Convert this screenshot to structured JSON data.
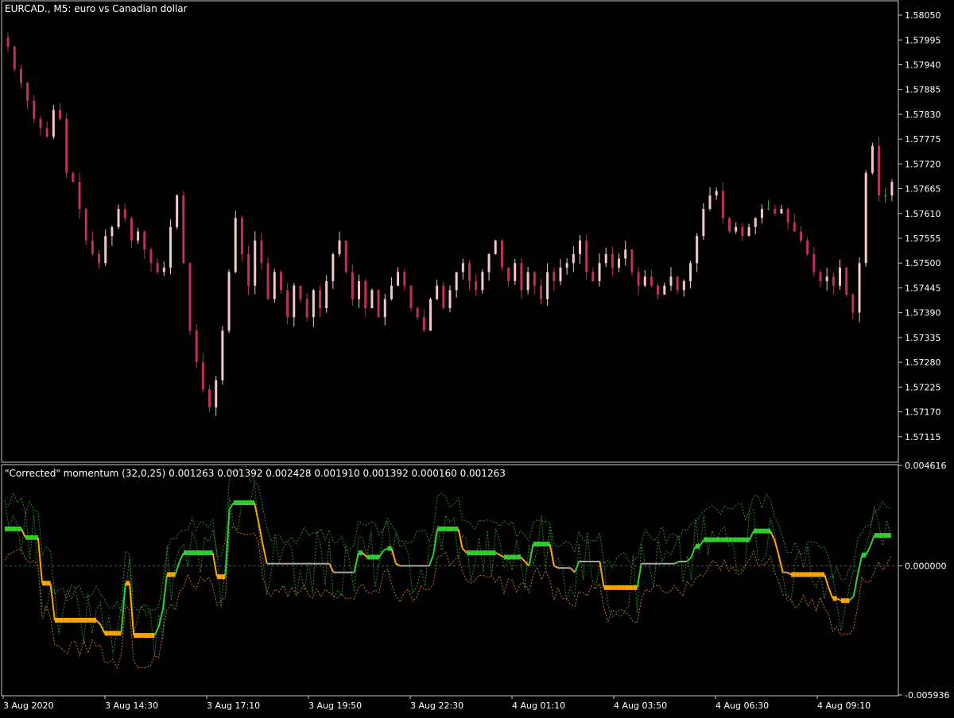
{
  "colors": {
    "background": "#000000",
    "frame": "#C8C8C8",
    "text": "#FFFFFF",
    "bull_candle": "#F4C7C9",
    "bear_candle": "#C0305A",
    "doji_candle": "#3CB43C",
    "momentum_up": "#32CD32",
    "momentum_down": "#FFA500",
    "momentum_neutral": "#A9A9A9",
    "band_green": "#2E8B2E",
    "band_orange": "#C07A20",
    "zero_line": "#555555"
  },
  "main_panel": {
    "title": "EURCAD., M5:  euro vs Canadian dollar",
    "y_ticks": [
      "1.58050",
      "1.57995",
      "1.57940",
      "1.57885",
      "1.57830",
      "1.57775",
      "1.57720",
      "1.57665",
      "1.57610",
      "1.57555",
      "1.57500",
      "1.57445",
      "1.57390",
      "1.57335",
      "1.57280",
      "1.57225",
      "1.57170",
      "1.57115"
    ]
  },
  "indicator_panel": {
    "title": "\"Corrected\" momentum (32,0,25) 0.001263 0.001392 0.002428 0.001910 0.001392 0.000160 0.001263",
    "y_ticks": [
      "0.004616",
      "0.000000",
      "-0.005936"
    ]
  },
  "x_axis": {
    "labels": [
      "3 Aug 2020",
      "3 Aug 14:30",
      "3 Aug 17:10",
      "3 Aug 19:50",
      "3 Aug 22:30",
      "4 Aug 01:10",
      "4 Aug 03:50",
      "4 Aug 06:30",
      "4 Aug 09:10"
    ]
  },
  "chart_data": [
    {
      "type": "candlestick",
      "title": "EURCAD., M5:  euro vs Canadian dollar",
      "ylim": [
        1.5706,
        1.5808
      ],
      "series": [
        {
          "name": "EURCAD.",
          "close": [
            1.5798,
            1.5793,
            1.579,
            1.5786,
            1.5782,
            1.578,
            1.5778,
            1.5784,
            1.5782,
            1.577,
            1.5768,
            1.5762,
            1.5755,
            1.5752,
            1.575,
            1.5756,
            1.5758,
            1.5762,
            1.576,
            1.5755,
            1.5757,
            1.5753,
            1.575,
            1.5748,
            1.5749,
            1.5758,
            1.5765,
            1.575,
            1.5735,
            1.5728,
            1.5722,
            1.5718,
            1.5724,
            1.5735,
            1.5748,
            1.576,
            1.5752,
            1.5745,
            1.5755,
            1.575,
            1.5742,
            1.5748,
            1.5744,
            1.5738,
            1.5745,
            1.5742,
            1.5738,
            1.5744,
            1.574,
            1.5746,
            1.5752,
            1.5755,
            1.5748,
            1.5742,
            1.5746,
            1.574,
            1.5744,
            1.5738,
            1.5742,
            1.5745,
            1.5748,
            1.5745,
            1.574,
            1.5738,
            1.5735,
            1.5742,
            1.5745,
            1.574,
            1.5744,
            1.5748,
            1.575,
            1.5746,
            1.5744,
            1.5748,
            1.5752,
            1.5755,
            1.5749,
            1.5746,
            1.575,
            1.5744,
            1.5748,
            1.5745,
            1.5742,
            1.5748,
            1.5746,
            1.5749,
            1.575,
            1.5752,
            1.5755,
            1.5748,
            1.5746,
            1.575,
            1.5752,
            1.5749,
            1.5751,
            1.5753,
            1.5748,
            1.5745,
            1.5747,
            1.5745,
            1.5743,
            1.5745,
            1.5747,
            1.5744,
            1.5746,
            1.575,
            1.5756,
            1.5762,
            1.5765,
            1.5766,
            1.576,
            1.5757,
            1.5758,
            1.5756,
            1.5758,
            1.576,
            1.5762,
            1.5762,
            1.5761,
            1.5762,
            1.5759,
            1.5757,
            1.5755,
            1.5752,
            1.5748,
            1.5746,
            1.5747,
            1.5745,
            1.5749,
            1.5743,
            1.5739,
            1.575,
            1.577,
            1.5776,
            1.5765,
            1.5765,
            1.5768
          ]
        }
      ]
    },
    {
      "type": "line",
      "title": "\"Corrected\" momentum (32,0,25)",
      "ylim": [
        -0.005936,
        0.004616
      ],
      "legend_values": [
        0.001263,
        0.001392,
        0.002428,
        0.00191,
        0.001392,
        0.00016,
        0.001263
      ],
      "series": [
        {
          "name": "Corrected momentum",
          "values": [
            0.0017,
            0.0017,
            0.0017,
            0.0017,
            0.0017,
            0.0013,
            0.0013,
            0.0013,
            0.0013,
            -0.0008,
            -0.0008,
            -0.0008,
            -0.0025,
            -0.0025,
            -0.0025,
            -0.0025,
            -0.0025,
            -0.0025,
            -0.0025,
            -0.0025,
            -0.0025,
            -0.0025,
            -0.0025,
            -0.0027,
            -0.0031,
            -0.0031,
            -0.0031,
            -0.0031,
            -0.0031,
            -0.0008,
            -0.0008,
            -0.0032,
            -0.0032,
            -0.0032,
            -0.0032,
            -0.0032,
            -0.0032,
            -0.0028,
            -0.002,
            -0.0004,
            -0.0004,
            -0.0004,
            0.0002,
            0.0006,
            0.0006,
            0.0006,
            0.0006,
            0.0006,
            0.0006,
            0.0006,
            0.0006,
            -0.0005,
            -0.0005,
            -0.0005,
            0.0026,
            0.0029,
            0.0029,
            0.0029,
            0.0029,
            0.0029,
            0.0029,
            0.002,
            0.001,
            0.0001,
            0.0001,
            0.0001,
            0.0001,
            0.0001,
            0.0001,
            0.0001,
            0.0001,
            0.0001,
            0.0001,
            0.0001,
            0.0001,
            0.0001,
            0.0001,
            0.0001,
            0.0001,
            -0.0003,
            -0.0003,
            -0.0003,
            -0.0003,
            -0.0003,
            -0.0003,
            0.0006,
            0.0006,
            0.0004,
            0.0004,
            0.0004,
            0.0004,
            0.0007,
            0.0008,
            0.0008,
            0.0001,
            0.0,
            0.0,
            0.0,
            0.0,
            0.0,
            0.0,
            0.0,
            0.0,
            0.0005,
            0.0017,
            0.0017,
            0.0017,
            0.0017,
            0.0017,
            0.0017,
            0.0008,
            0.0006,
            0.0006,
            0.0006,
            0.0006,
            0.0006,
            0.0006,
            0.0006,
            0.0006,
            0.0005,
            0.0004,
            0.0004,
            0.0004,
            0.0004,
            0.0004,
            0.0002,
            0.0,
            0.001,
            0.001,
            0.001,
            0.001,
            0.001,
            0.0,
            -0.0001,
            -0.0001,
            -0.0001,
            -0.0001,
            -0.0003,
            0.0002,
            0.0002,
            0.0002,
            0.0002,
            0.0002,
            0.0002,
            -0.001,
            -0.001,
            -0.001,
            -0.001,
            -0.001,
            -0.001,
            -0.001,
            -0.001,
            -0.001,
            0.0001,
            0.0001,
            0.0001,
            0.0001,
            0.0001,
            0.0001,
            0.0001,
            0.0001,
            0.0001,
            0.0002,
            0.0002,
            0.0002,
            0.0004,
            0.0009,
            0.0009,
            0.0012,
            0.0012,
            0.0012,
            0.0012,
            0.0012,
            0.0012,
            0.0012,
            0.0012,
            0.0012,
            0.0012,
            0.0012,
            0.0012,
            0.0016,
            0.0016,
            0.0016,
            0.0016,
            0.0016,
            0.0012,
            0.0005,
            -0.0003,
            -0.0003,
            -0.0004,
            -0.0004,
            -0.0004,
            -0.0004,
            -0.0004,
            -0.0004,
            -0.0004,
            -0.0004,
            -0.0004,
            -0.001,
            -0.0015,
            -0.0015,
            -0.0016,
            -0.0016,
            -0.0016,
            -0.0014,
            -0.0004,
            0.0005,
            0.0005,
            0.0009,
            0.0014,
            0.0014,
            0.0014,
            0.0014,
            0.0014
          ]
        }
      ]
    }
  ]
}
